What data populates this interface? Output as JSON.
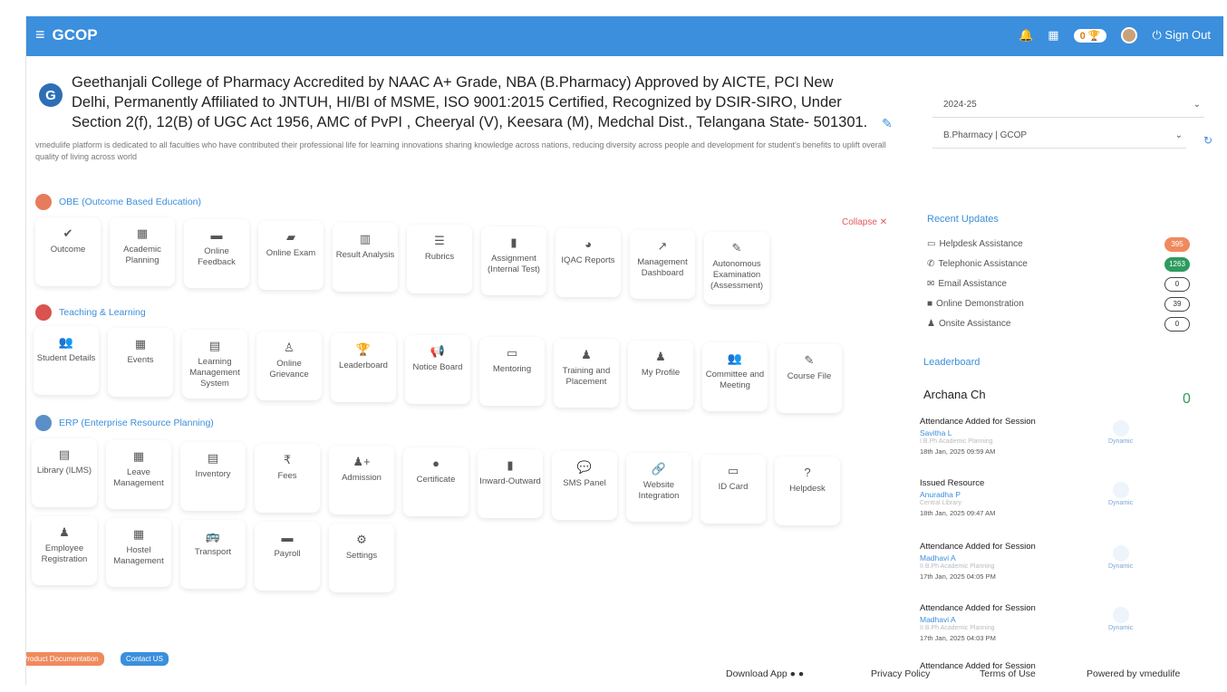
{
  "topbar": {
    "app_name": "GCOP",
    "trophy_count": "0",
    "sign_out": "Sign Out"
  },
  "header": {
    "college_name": "Geethanjali College of Pharmacy Accredited by NAAC A+ Grade, NBA (B.Pharmacy) Approved by AICTE, PCI New Delhi, Permanently Affiliated to JNTUH, HI/BI of MSME, ISO 9001:2015 Certified, Recognized by DSIR-SIRO, Under Section 2(f), 12(B) of UGC Act 1956, AMC of PvPI , Cheeryal (V), Keesara (M), Medchal Dist., Telangana State- 501301.",
    "tagline": "vmedulife platform is dedicated to all faculties who have contributed their professional life for learning innovations sharing knowledge across nations, reducing diversity across people and development for student's benefits to uplift overall quality of living across world",
    "year_select": "2024-25",
    "program_select": "B.Pharmacy | GCOP"
  },
  "sections": {
    "obe": {
      "title": "OBE (Outcome Based Education)",
      "collapse": "Collapse",
      "items": [
        "Outcome",
        "Academic Planning",
        "Online Feedback",
        "Online Exam",
        "Result Analysis",
        "Rubrics",
        "Assignment (Internal Test)",
        "IQAC Reports",
        "Management Dashboard",
        "Autonomous Examination (Assessment)"
      ]
    },
    "teaching": {
      "title": "Teaching & Learning",
      "items": [
        "Student Details",
        "Events",
        "Learning Management System",
        "Online Grievance",
        "Leaderboard",
        "Notice Board",
        "Mentoring",
        "Training and Placement",
        "My Profile",
        "Committee and Meeting",
        "Course File"
      ]
    },
    "erp": {
      "title": "ERP (Enterprise Resource Planning)",
      "items": [
        "Library (ILMS)",
        "Leave Management",
        "Inventory",
        "Fees",
        "Admission",
        "Certificate",
        "Inward-Outward",
        "SMS Panel",
        "Website Integration",
        "ID Card",
        "Helpdesk",
        "Employee Registration",
        "Hostel Management",
        "Transport",
        "Payroll",
        "Settings"
      ]
    }
  },
  "recent_updates": {
    "title": "Recent Updates",
    "items": [
      {
        "label": "Helpdesk Assistance",
        "count": "395"
      },
      {
        "label": "Telephonic Assistance",
        "count": "1263"
      },
      {
        "label": "Email Assistance",
        "count": "0"
      },
      {
        "label": "Online Demonstration",
        "count": "39"
      },
      {
        "label": "Onsite Assistance",
        "count": "0"
      }
    ]
  },
  "leaderboard": {
    "title": "Leaderboard",
    "name": "Archana Ch",
    "score": "0",
    "activities": [
      {
        "title": "Attendance Added for Session",
        "person": "Savitha L",
        "sub": "I B.Ph Academic Planning",
        "date": "18th Jan, 2025 09:59 AM",
        "tag": "Dynamic"
      },
      {
        "title": "Issued Resource",
        "person": "Anuradha P",
        "sub": "Central Library",
        "date": "18th Jan, 2025 09:47 AM",
        "tag": "Dynamic"
      },
      {
        "title": "Attendance Added for Session",
        "person": "Madhavi A",
        "sub": "II B.Ph Academic Planning",
        "date": "17th Jan, 2025 04:05 PM",
        "tag": "Dynamic"
      },
      {
        "title": "Attendance Added for Session",
        "person": "Madhavi A",
        "sub": "II B.Ph Academic Planning",
        "date": "17th Jan, 2025 04:03 PM",
        "tag": "Dynamic"
      },
      {
        "title": "Attendance Added for Session",
        "person": "",
        "sub": "",
        "date": "",
        "tag": ""
      }
    ]
  },
  "footer": {
    "product_doc": "Product Documentation",
    "contact_us": "Contact US",
    "download_app": "Download App",
    "privacy": "Privacy Policy",
    "terms": "Terms of Use",
    "powered": "Powered by vmedulife"
  }
}
